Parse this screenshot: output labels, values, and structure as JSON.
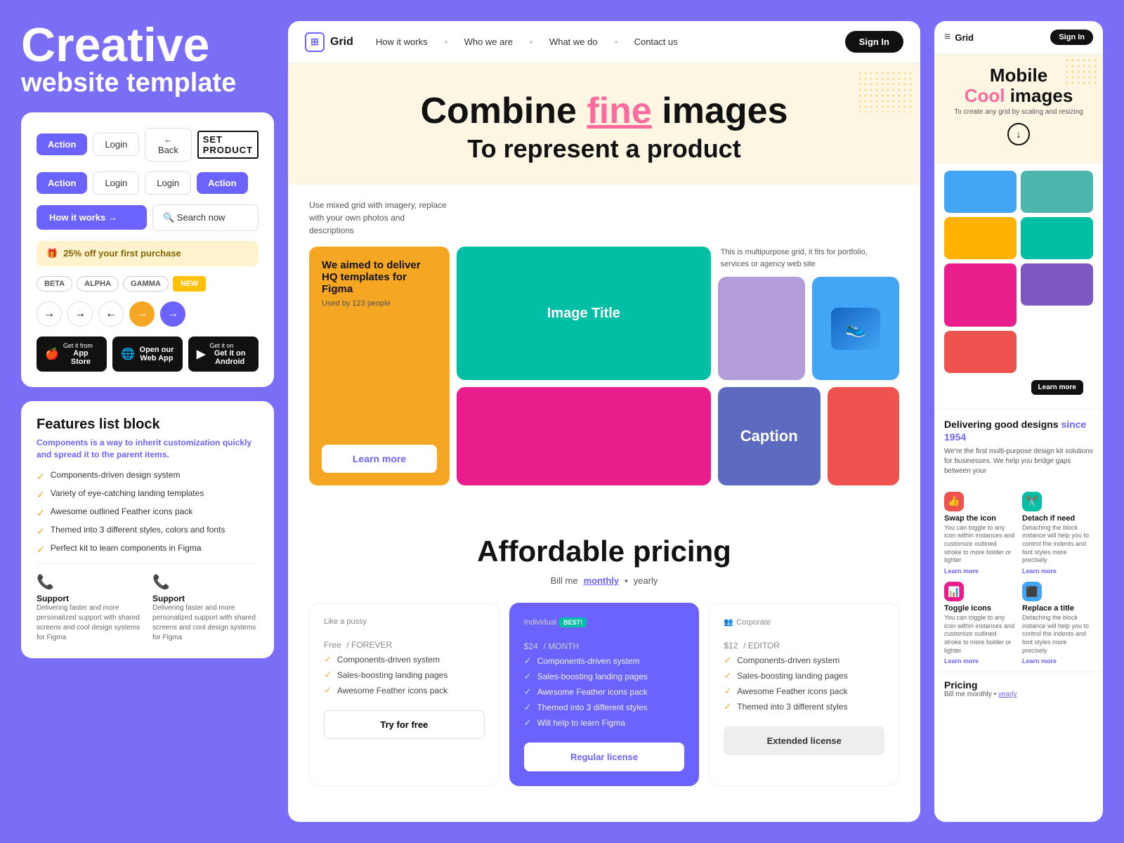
{
  "hero": {
    "title": "Creative",
    "subtitle": "website template"
  },
  "ui_card": {
    "btn1": "Action",
    "btn2": "Login",
    "btn3": "← Back",
    "btn4": "Action",
    "btn5": "Login",
    "btn6": "Login",
    "btn7": "Action",
    "how_it_works": "How it works →",
    "search_now": "🔍 Search now",
    "discount": "25% off your first purchase",
    "tags": [
      "BETA",
      "ALPHA",
      "GAMMA",
      "NEW"
    ],
    "app_store": "App Store",
    "web_app": "Open our Web App",
    "android": "Get it on Android"
  },
  "features": {
    "title": "Features list block",
    "subtitle": "Components is a way to inherit customization quickly and spread it to the parent items.",
    "items": [
      "Components-driven design system",
      "Variety of eye-catching landing templates",
      "Awesome outlined Feather icons pack",
      "Themed into 3 different styles, colors and fonts",
      "Perfect kit to learn components in Figma"
    ],
    "support1_title": "Support",
    "support1_desc": "Delivering faster and more personalized support with shared screens and cool design systems for Figma",
    "support2_title": "Support",
    "support2_desc": "Delivering faster and more personalized support with shared screens and cool design systems for Figma"
  },
  "nav": {
    "logo": "Grid",
    "links": [
      "How it works",
      "Who we are",
      "What we do",
      "Contact us"
    ],
    "signin": "Sign In"
  },
  "center_hero": {
    "line1_start": "Combine ",
    "line1_highlight": "fine",
    "line1_end": " images",
    "line2": "To represent a product",
    "left_text": "Use mixed grid with imagery, replace with your own photos and descriptions",
    "right_text": "This is multipurpose grid, it fits for portfolio, services or agency web site",
    "promo_title": "We aimed to deliver HQ templates for Figma",
    "promo_sub": "Used by 123 people",
    "image_title": "Image Title",
    "caption": "Caption",
    "learn_more": "Learn more"
  },
  "pricing": {
    "title": "Affordable pricing",
    "billing_label": "Bill me",
    "billing_monthly": "monthly",
    "billing_yearly": "yearly",
    "plans": [
      {
        "type": "Like a pussy",
        "name": "Free",
        "period": "/ FOREVER",
        "features": [
          "Components-driven system",
          "Sales-boosting landing pages",
          "Awesome Feather icons pack"
        ],
        "btn": "Try for free",
        "featured": false
      },
      {
        "type": "Individual",
        "badge": "BEST!",
        "name": "$24",
        "period": "/ MONTH",
        "features": [
          "Components-driven system",
          "Sales-boosting landing pages",
          "Awesome Feather icons pack",
          "Themed into 3 different styles",
          "Will help to learn Figma"
        ],
        "btn": "Regular license",
        "featured": true
      },
      {
        "type": "Corporate",
        "icon": "👥",
        "name": "$12",
        "period": "/ EDITOR",
        "features": [
          "Components-driven system",
          "Sales-boosting landing pages",
          "Awesome Feather icons pack",
          "Themed into 3 different styles"
        ],
        "btn": "Extended license",
        "featured": false
      }
    ]
  },
  "mobile": {
    "logo": "Grid",
    "signin": "Sign In",
    "hero_title1": "Mobile",
    "hero_title2_pink": "Cool",
    "hero_title2_end": " images",
    "hero_desc": "To create any grid by scaling and resizing",
    "text_section_title": "Delivering good designs since 1954",
    "text_section_accent": "since 1954",
    "text_section_body": "We're the first multi-purpose design kit solutions for businesses. We help you bridge gaps between your",
    "learn_more": "Learn more",
    "features": [
      {
        "icon": "👍",
        "color": "red",
        "title": "Swap the icon",
        "desc": "You can toggle to any icon within instances and customize outlined stroke to more bolder or lighter"
      },
      {
        "icon": "✂️",
        "color": "green",
        "title": "Detach if need",
        "desc": "Detaching the block instance will help you to control the indents and font styles more precisely"
      },
      {
        "icon": "📊",
        "color": "pink",
        "title": "Toggle icons",
        "desc": "You can toggle to any icon within instances and customize outlined stroke to more bolder or lighter"
      },
      {
        "icon": "⬛",
        "color": "blue",
        "title": "Replace a title",
        "desc": "Detaching the block instance will help you to control the indents and font styles more precisely"
      }
    ],
    "pricing_title": "Pricing",
    "pricing_billing": "Bill me monthly •",
    "pricing_yearly": "yearly"
  }
}
